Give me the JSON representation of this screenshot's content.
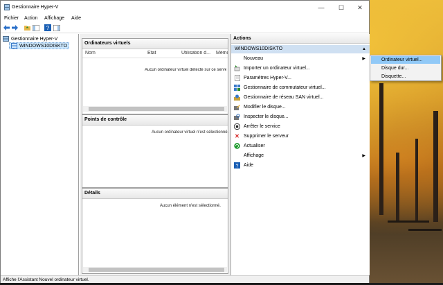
{
  "window": {
    "title": "Gestionnaire Hyper-V",
    "controls": {
      "minimize": "—",
      "maximize": "☐",
      "close": "✕"
    }
  },
  "menubar": {
    "items": [
      "Fichier",
      "Action",
      "Affichage",
      "Aide"
    ]
  },
  "tree": {
    "root": "Gestionnaire Hyper-V",
    "server": "WINDOWS10DISKTO"
  },
  "center": {
    "vms": {
      "title": "Ordinateurs virtuels",
      "columns": [
        "Nom",
        "État",
        "Utilisation d...",
        "Mémo"
      ],
      "empty": "Aucun ordinateur virtuel détecté sur ce serve"
    },
    "checkpoints": {
      "title": "Points de contrôle",
      "empty": "Aucun ordinateur virtuel n'est sélectionné."
    },
    "details": {
      "title": "Détails",
      "empty": "Aucun élément n'est sélectionné."
    }
  },
  "actions": {
    "title": "Actions",
    "server": "WINDOWS10DISKTO",
    "items": [
      {
        "label": "Nouveau",
        "icon": "blank",
        "submenu": true
      },
      {
        "label": "Importer un ordinateur virtuel...",
        "icon": "import-icon"
      },
      {
        "label": "Paramètres Hyper-V...",
        "icon": "settings-doc-icon"
      },
      {
        "label": "Gestionnaire de commutateur virtuel...",
        "icon": "switch-icon"
      },
      {
        "label": "Gestionnaire de réseau SAN virtuel...",
        "icon": "san-icon"
      },
      {
        "label": "Modifier le disque...",
        "icon": "edit-disk-icon"
      },
      {
        "label": "Inspecter le disque...",
        "icon": "inspect-disk-icon"
      },
      {
        "label": "Arrêter le service",
        "icon": "stop-icon"
      },
      {
        "label": "Supprimer le serveur",
        "icon": "delete-icon"
      },
      {
        "label": "Actualiser",
        "icon": "refresh-icon"
      },
      {
        "label": "Affichage",
        "icon": "blank",
        "submenu": true
      },
      {
        "label": "Aide",
        "icon": "help-icon"
      }
    ]
  },
  "submenu": {
    "items": [
      "Ordinateur virtuel...",
      "Disque dur...",
      "Disquette..."
    ],
    "highlighted": 0
  },
  "statusbar": {
    "text": "Affiche l'Assistant Nouvel ordinateur virtuel."
  },
  "colors": {
    "selection": "#cce8ff",
    "action_header": "#cfe0f2",
    "submenu_highlight": "#91c9f7",
    "stop_red": "#d41c1c",
    "refresh_green": "#1a9a2a",
    "help_blue": "#1a5fb4"
  }
}
